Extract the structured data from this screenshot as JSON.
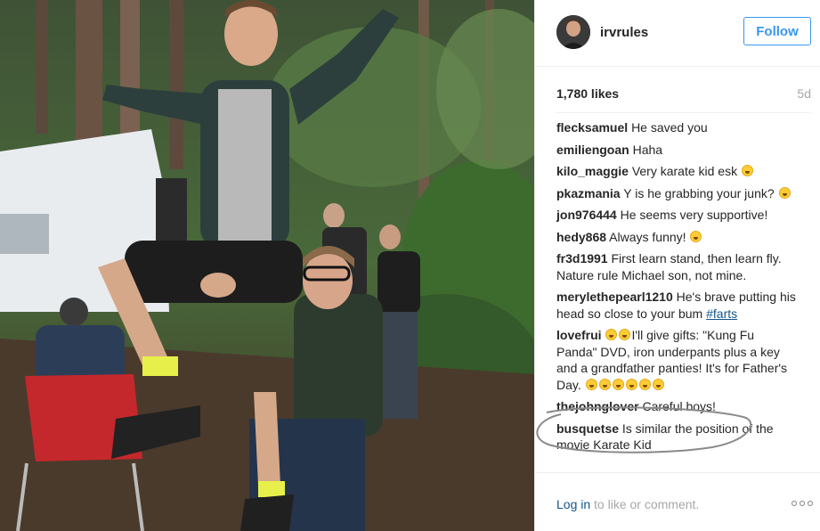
{
  "post": {
    "username": "irvrules",
    "follow_label": "Follow",
    "likes": "1,780 likes",
    "age": "5d"
  },
  "comments": [
    {
      "user": "flecksamuel",
      "text": "He saved you"
    },
    {
      "user": "emiliengoan",
      "text": "Haha"
    },
    {
      "user": "kilo_maggie",
      "text": "Very karate kid esk",
      "emoji": 1
    },
    {
      "user": "pkazmania",
      "text": "Y is he grabbing your junk?",
      "emoji": 1
    },
    {
      "user": "jon976444",
      "text": "He seems very supportive!"
    },
    {
      "user": "hedy868",
      "text": "Always funny!",
      "emoji": 1
    },
    {
      "user": "fr3d1991",
      "text": "First learn stand, then learn fly. Nature rule Michael son, not mine."
    },
    {
      "user": "merylethepearl1210",
      "text": "He's brave putting his head so close to your bum ",
      "hashtag": "#farts"
    },
    {
      "user": "lovefrui",
      "text": "I'll give gifts: \"Kung Fu Panda\" DVD, iron underpants plus a key and a grandfather panties! It's for Father's Day.",
      "emoji_lead": 2,
      "emoji": 6
    },
    {
      "user": "thejohnglover",
      "text": "Careful boys!"
    },
    {
      "user": "busquetse",
      "text": "Is similar the position of the movie Karate Kid"
    }
  ],
  "footer": {
    "login_link": "Log in",
    "login_rest": " to like or comment."
  },
  "icons": {
    "more": "more-options-icon",
    "emoji": "grinning-face-emoji"
  },
  "colors": {
    "accent": "#3897f0",
    "link": "#125688",
    "muted": "#a5a7aa"
  }
}
